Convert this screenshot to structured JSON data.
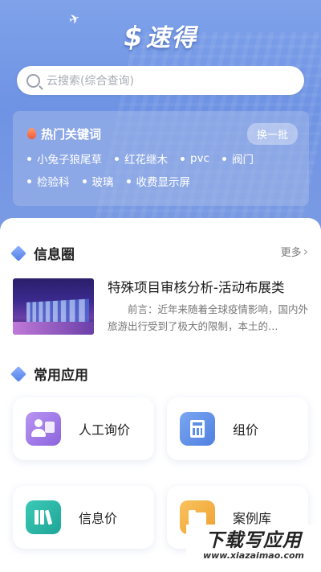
{
  "header": {
    "logo_mark": "$",
    "logo_text": "速得"
  },
  "search": {
    "placeholder": "云搜索(综合查询)"
  },
  "hot_keywords": {
    "title": "热门关键词",
    "swap_label": "换一批",
    "rows": [
      [
        "小兔子狼尾草",
        "红花继木",
        "pvc",
        "阀门"
      ],
      [
        "检验科",
        "玻璃",
        "收费显示屏"
      ]
    ]
  },
  "info_circle": {
    "title": "信息圈",
    "more_label": "更多",
    "article": {
      "title": "特殊项目审核分析-活动布展类",
      "desc": "前言：近年来随着全球疫情影响，国内外旅游出行受到了极大的限制，本土的…"
    }
  },
  "apps": {
    "title": "常用应用",
    "items": [
      {
        "label": "人工询价",
        "icon": "user-chat-icon",
        "color": "#a57ee8"
      },
      {
        "label": "组价",
        "icon": "calculator-icon",
        "color": "#5b8ee6"
      },
      {
        "label": "信息价",
        "icon": "books-icon",
        "color": "#24b6a8"
      },
      {
        "label": "案例库",
        "icon": "folder-icon",
        "color": "#f5b044"
      }
    ]
  },
  "watermark": {
    "main": "下载写应用",
    "sub": "www.xiazaimao.com"
  }
}
